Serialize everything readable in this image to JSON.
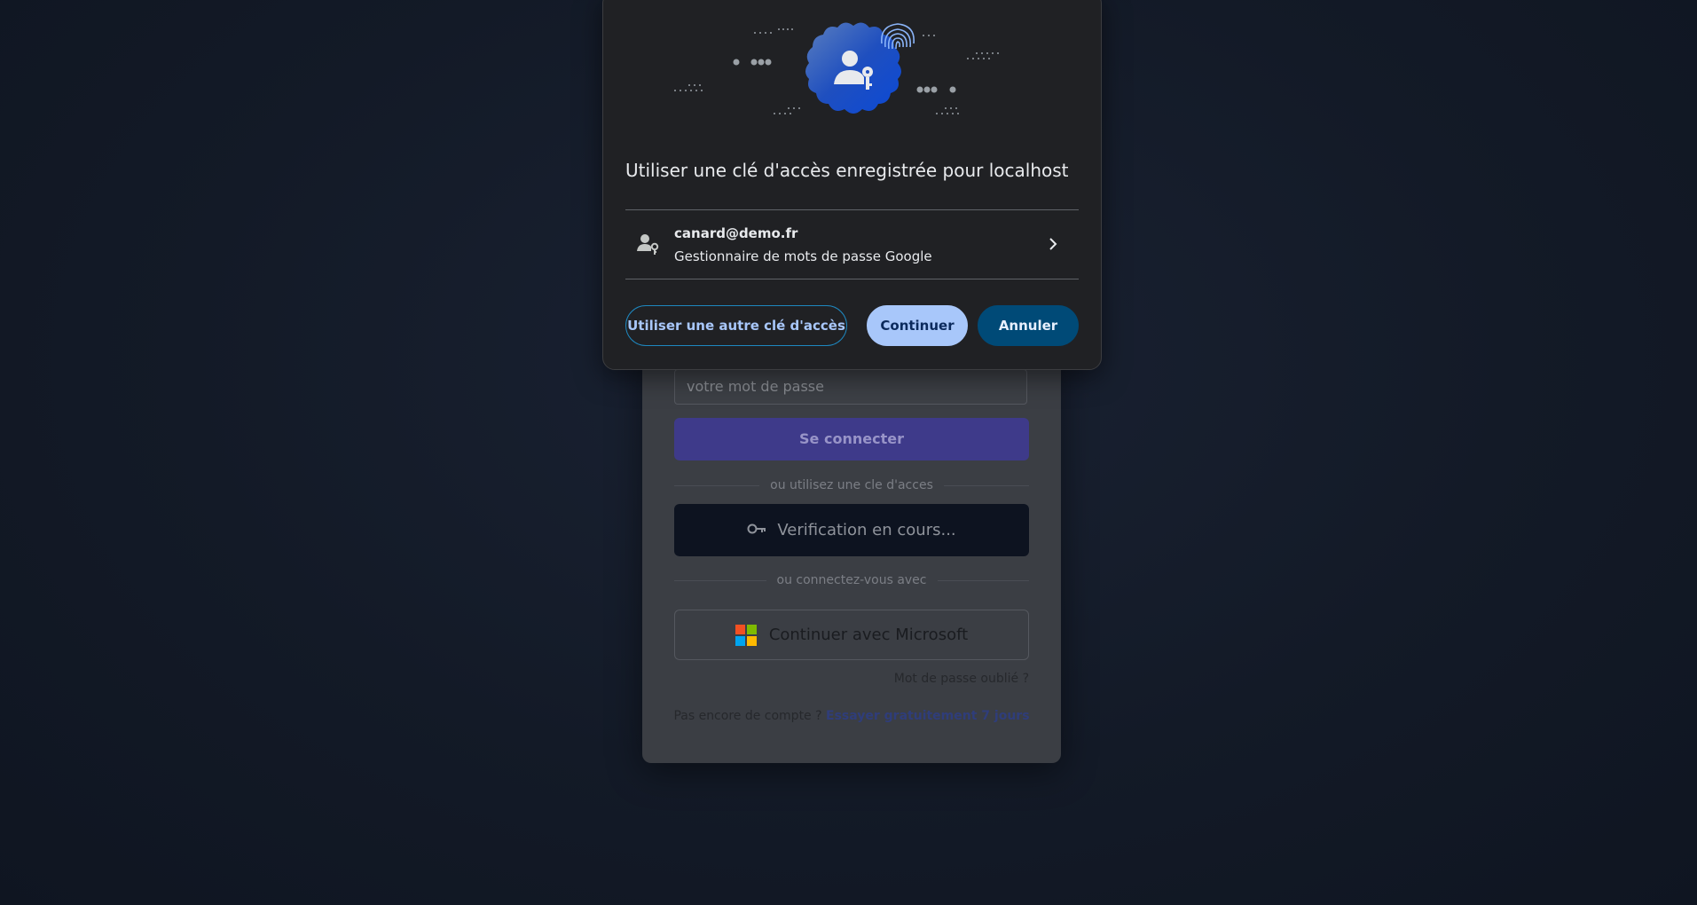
{
  "login": {
    "password_placeholder": "votre mot de passe",
    "login_button": "Se connecter",
    "passkey_divider": "ou utilisez une cle d'acces",
    "passkey_button": "Verification en cours...",
    "social_divider": "ou connectez-vous avec",
    "microsoft_button": "Continuer avec Microsoft",
    "forgot_password": "Mot de passe oublié ?",
    "signup_prompt": "Pas encore de compte ?",
    "signup_link": "Essayer gratuitement 7 jours"
  },
  "dialog": {
    "title": "Utiliser une clé d'accès enregistrée pour localhost",
    "account": {
      "email": "canard@demo.fr",
      "provider": "Gestionnaire de mots de passe Google",
      "icon": "person-key-icon"
    },
    "buttons": {
      "other_passkey": "Utiliser une autre clé d'accès",
      "continue": "Continuer",
      "cancel": "Annuler"
    }
  },
  "colors": {
    "dialog_bg": "#202124",
    "accent_light": "#a8c7fa",
    "accent_dark": "#004a77",
    "microsoft": [
      "#f25022",
      "#7fba00",
      "#00a4ef",
      "#ffb900"
    ]
  }
}
